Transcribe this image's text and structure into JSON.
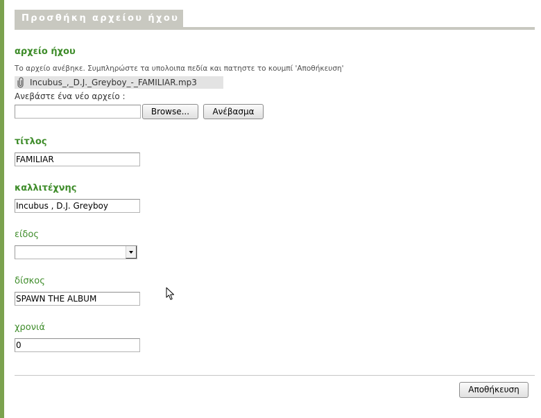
{
  "colors": {
    "accent_green": "#3e8c2a",
    "left_bar": "#7ba24e",
    "header_bg": "#c8c8c0",
    "header_text": "#ffffff"
  },
  "header": {
    "title": "Προσθήκη αρχείου ήχου"
  },
  "audio_file": {
    "label": "αρχείο ήχου",
    "status_message": "Το αρχείο ανέβηκε. Συμπληρώστε τα υπολοιπα πεδία και πατηστε το κουμπί 'Αποθήκευση'",
    "attachment": {
      "icon": "paperclip-icon",
      "filename": "Incubus_,_D.J._Greyboy_-_FAMILIAR.mp3"
    },
    "upload_new_label": "Ανεβάστε ένα νέο αρχείο :",
    "browse_label": "Browse...",
    "upload_label": "Ανέβασμα"
  },
  "fields": {
    "title": {
      "label": "τίτλος",
      "value": "FAMILIAR"
    },
    "artist": {
      "label": "καλλιτέχνης",
      "value": "Incubus , D.J. Greyboy"
    },
    "genre": {
      "label": "είδος",
      "selected": ""
    },
    "album": {
      "label": "δίσκος",
      "value": "SPAWN THE ALBUM"
    },
    "year": {
      "label": "χρονιά",
      "value": "0"
    }
  },
  "actions": {
    "save_label": "Αποθήκευση"
  }
}
